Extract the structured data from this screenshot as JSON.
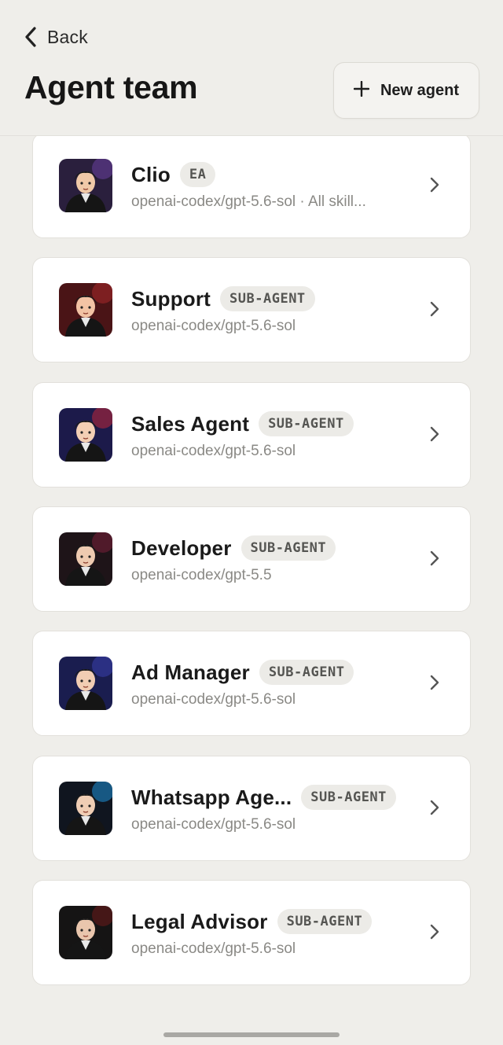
{
  "header": {
    "back_label": "Back",
    "title": "Agent team",
    "new_agent_label": "New agent"
  },
  "agents": [
    {
      "name": "Clio",
      "badge": "EA",
      "model": "openai-codex/gpt-5.6-sol · All skill...",
      "avatar_icon": "clio-avatar-icon",
      "avatar_colors": [
        "#2a1f3d",
        "#6a3fa0",
        "#f0c9a8"
      ]
    },
    {
      "name": "Support",
      "badge": "SUB-AGENT",
      "model": "openai-codex/gpt-5.6-sol",
      "avatar_icon": "support-avatar-icon",
      "avatar_colors": [
        "#4a1416",
        "#a8282c",
        "#f2c3a4"
      ]
    },
    {
      "name": "Sales Agent",
      "badge": "SUB-AGENT",
      "model": "openai-codex/gpt-5.6-sol",
      "avatar_icon": "sales-avatar-icon",
      "avatar_colors": [
        "#1c1a4a",
        "#c0283a",
        "#f3cfb4"
      ]
    },
    {
      "name": "Developer",
      "badge": "SUB-AGENT",
      "model": "openai-codex/gpt-5.5",
      "avatar_icon": "developer-avatar-icon",
      "avatar_colors": [
        "#1e1418",
        "#7a1f3a",
        "#eecab0"
      ]
    },
    {
      "name": "Ad Manager",
      "badge": "SUB-AGENT",
      "model": "openai-codex/gpt-5.6-sol",
      "avatar_icon": "ad-manager-avatar-icon",
      "avatar_colors": [
        "#1a1d4f",
        "#3b3fae",
        "#f1cdb3"
      ]
    },
    {
      "name": "Whatsapp Age...",
      "badge": "SUB-AGENT",
      "model": "openai-codex/gpt-5.6-sol",
      "avatar_icon": "whatsapp-avatar-icon",
      "avatar_colors": [
        "#10151f",
        "#1e8fd6",
        "#efcdb4"
      ]
    },
    {
      "name": "Legal Advisor",
      "badge": "SUB-AGENT",
      "model": "openai-codex/gpt-5.6-sol",
      "avatar_icon": "legal-avatar-icon",
      "avatar_colors": [
        "#151414",
        "#6d1a1a",
        "#e9c6ad"
      ]
    }
  ],
  "colors": {
    "background": "#efeeea",
    "card": "#ffffff",
    "badge_bg": "#ecebe7",
    "muted_text": "#8a8985"
  }
}
